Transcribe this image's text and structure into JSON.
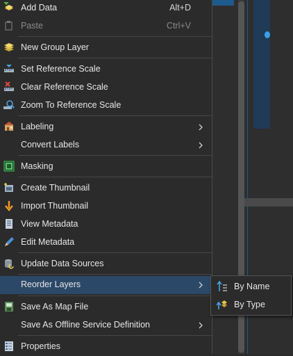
{
  "menu": {
    "items": [
      {
        "label": "Add Data",
        "shortcut": "Alt+D",
        "icon": "add-data-icon"
      },
      {
        "label": "Paste",
        "shortcut": "Ctrl+V",
        "icon": "paste-icon",
        "disabled": true
      },
      {
        "label": "New Group Layer",
        "icon": "group-layer-icon"
      },
      {
        "label": "Set Reference Scale",
        "icon": "set-reference-scale-icon"
      },
      {
        "label": "Clear Reference Scale",
        "icon": "clear-reference-scale-icon"
      },
      {
        "label": "Zoom To Reference Scale",
        "icon": "zoom-reference-scale-icon"
      },
      {
        "label": "Labeling",
        "icon": "labeling-icon",
        "submenu": true
      },
      {
        "label": "Convert Labels",
        "submenu": true
      },
      {
        "label": "Masking",
        "icon": "masking-icon"
      },
      {
        "label": "Create Thumbnail",
        "icon": "create-thumbnail-icon"
      },
      {
        "label": "Import Thumbnail",
        "icon": "import-thumbnail-icon"
      },
      {
        "label": "View Metadata",
        "icon": "view-metadata-icon"
      },
      {
        "label": "Edit Metadata",
        "icon": "edit-metadata-icon"
      },
      {
        "label": "Update Data Sources",
        "icon": "update-data-sources-icon"
      },
      {
        "label": "Reorder Layers",
        "submenu": true,
        "highlighted": true
      },
      {
        "label": "Save As Map File",
        "icon": "save-map-file-icon"
      },
      {
        "label": "Save As Offline Service Definition",
        "submenu": true
      },
      {
        "label": "Properties",
        "icon": "properties-icon"
      }
    ]
  },
  "submenu": {
    "items": [
      {
        "label": "By Name",
        "icon": "sort-by-name-icon"
      },
      {
        "label": "By Type",
        "icon": "sort-by-type-icon"
      }
    ]
  },
  "colors": {
    "highlight": "#2c4868",
    "accent": "#3aa0e8"
  }
}
